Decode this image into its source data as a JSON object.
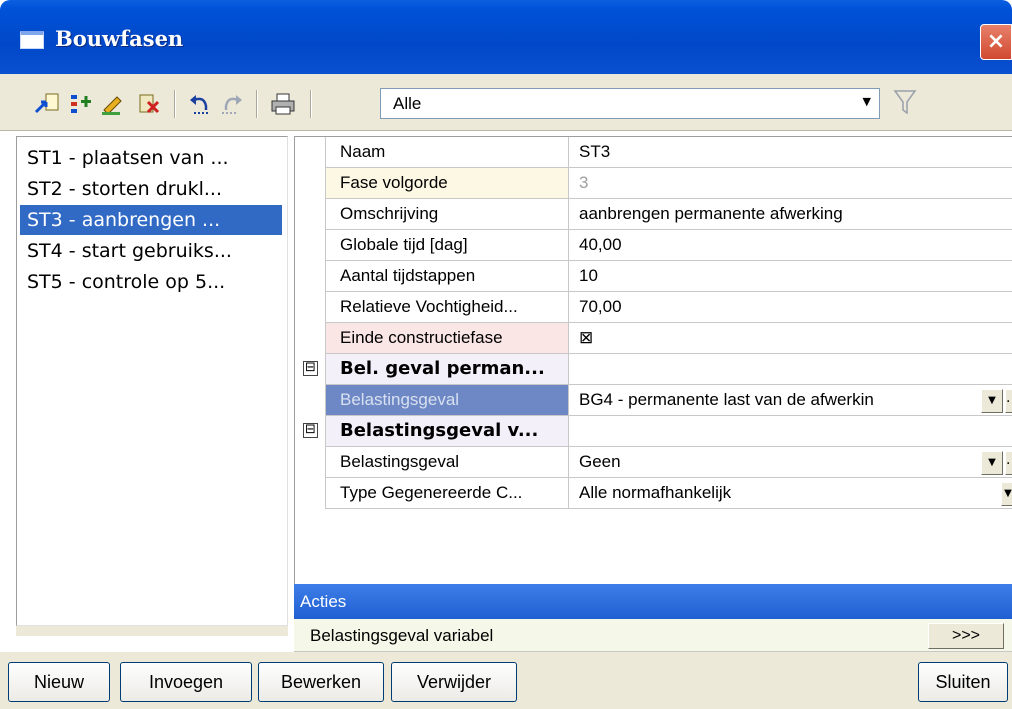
{
  "window": {
    "title": "Bouwfasen",
    "close_label": "×"
  },
  "toolbar": {
    "icons": [
      "new-phase-icon",
      "insert-phase-icon",
      "edit-icon",
      "delete-icon",
      "undo-icon",
      "redo-icon",
      "print-icon"
    ],
    "filter_value": "Alle",
    "filter_arrow": "▼",
    "funnel": "filter-icon"
  },
  "phases": [
    "ST1 - plaatsen van ...",
    "ST2 - storten drukl...",
    "ST3 - aanbrengen ...",
    "ST4 - start gebruiks...",
    "ST5 - controle op 5..."
  ],
  "selected_phase_index": 2,
  "properties": [
    {
      "name": "Naam",
      "value": "ST3"
    },
    {
      "name": "Fase volgorde",
      "value": "3"
    },
    {
      "name": "Omschrijving",
      "value": "aanbrengen permanente afwerking"
    },
    {
      "name": "Globale tijd [dag]",
      "value": "40,00"
    },
    {
      "name": "Aantal tijdstappen",
      "value": "10"
    },
    {
      "name": "Relatieve Vochtigheid...",
      "value": "70,00"
    },
    {
      "name": "Einde constructiefase",
      "value": "⊠"
    }
  ],
  "category1": {
    "toggle": "⊟",
    "name": "Bel. geval perman...",
    "row": {
      "name": "Belastingsgeval",
      "value": "BG4 - permanente last van de afwerkin"
    }
  },
  "category2": {
    "toggle": "⊟",
    "name": "Belastingsgeval v...",
    "rows": [
      {
        "name": "Belastingsgeval",
        "value": "Geen"
      },
      {
        "name": "Type Gegenereerde C...",
        "value": "Alle normafhankelijk"
      }
    ]
  },
  "dropdown_arrow": "▼",
  "ellipsis": "...",
  "acties": {
    "title": "Acties",
    "row_label": "Belastingsgeval variabel",
    "row_button": ">>>"
  },
  "buttons": {
    "nieuw": "Nieuw",
    "invoegen": "Invoegen",
    "bewerken": "Bewerken",
    "verwijder": "Verwijder",
    "sluiten": "Sluiten"
  },
  "colors": {
    "title_bar": "#0048c8",
    "selection": "#316ac5",
    "fase_volgorde_bg": "#fdf8e4",
    "einde_bg": "#fbe6e6",
    "category_bg": "#f4f0fa",
    "selected_prop_bg": "#6d88c4"
  }
}
